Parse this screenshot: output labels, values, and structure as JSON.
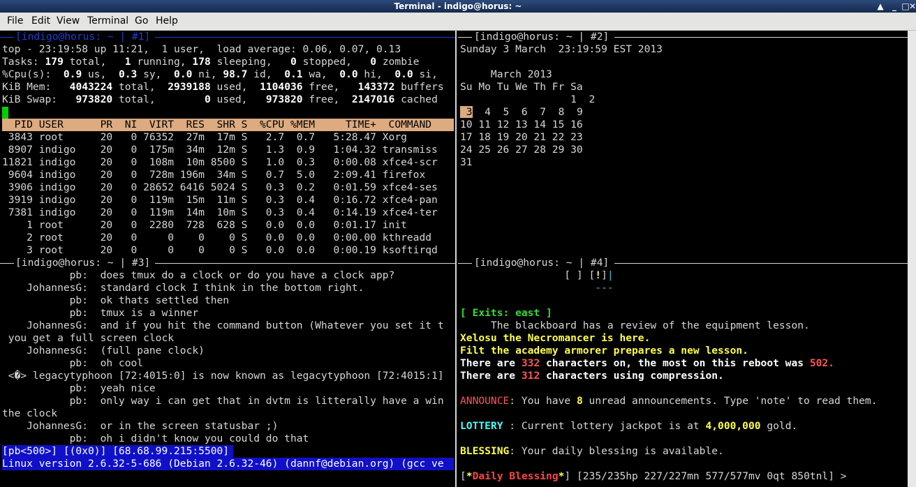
{
  "window": {
    "title": "Terminal - indigo@horus: ~",
    "btn_up": "▲",
    "btn_min": "_",
    "btn_max": "□",
    "btn_close": "✕"
  },
  "menu": [
    "File",
    "Edit",
    "View",
    "Terminal",
    "Go",
    "Help"
  ],
  "pane1": {
    "title": "[indigo@horus: ~ | #1]",
    "top_line": "top - 23:19:58 up 11:21,  1 user,  load average: 0.06, 0.07, 0.13",
    "tasks": {
      "label": "Tasks:",
      "total": "179",
      "total_l": " total,   ",
      "running": "1",
      "running_l": " running, ",
      "sleeping": "178",
      "sleeping_l": " sleeping,   ",
      "stopped": "0",
      "stopped_l": " stopped,   ",
      "zombie": "0",
      "zombie_l": " zombie"
    },
    "cpu": {
      "label": "%Cpu(s):  ",
      "us": "0.9",
      "us_l": " us,  ",
      "sy": "0.3",
      "sy_l": " sy,  ",
      "ni": "0.0",
      "ni_l": " ni, ",
      "id": "98.7",
      "id_l": " id,  ",
      "wa": "0.1",
      "wa_l": " wa,  ",
      "hi": "0.0",
      "hi_l": " hi,  ",
      "si": "0.0",
      "si_l": " si,"
    },
    "mem": {
      "label": "KiB Mem:   ",
      "total": "4043224",
      "total_l": " total,  ",
      "used": "2939188",
      "used_l": " used,  ",
      "free": "1104036",
      "free_l": " free,   ",
      "buffers": "143372",
      "buffers_l": " buffers"
    },
    "swap": {
      "label": "KiB Swap:   ",
      "total": "973820",
      "total_l": " total,        ",
      "used": "0",
      "used_l": " used,   ",
      "free": "973820",
      "free_l": " free,  ",
      "cached": "2147016",
      "cached_l": " cached"
    },
    "table_header": "  PID USER      PR  NI  VIRT  RES  SHR S  %CPU %MEM     TIME+  COMMAND       ",
    "rows": [
      " 3843 root      20   0 76352  27m  17m S   2.7  0.7   5:28.47 Xorg",
      " 8907 indigo    20   0  175m  34m  12m S   1.3  0.9   1:04.32 transmiss",
      "11821 indigo    20   0  108m  10m 8500 S   1.0  0.3   0:00.08 xfce4-scr",
      " 9604 indigo    20   0  728m 196m  34m S   0.7  5.0   2:09.41 firefox",
      " 3906 indigo    20   0 28652 6416 5024 S   0.3  0.2   0:01.59 xfce4-ses",
      " 3919 indigo    20   0  119m  15m  11m S   0.3  0.4   0:16.72 xfce4-pan",
      " 7381 indigo    20   0  119m  14m  10m S   0.3  0.4   0:14.19 xfce4-ter",
      "    1 root      20   0  2280  728  628 S   0.0  0.0   0:01.17 init",
      "    2 root      20   0     0    0    0 S   0.0  0.0   0:00.00 kthreadd",
      "    3 root      20   0     0    0    0 S   0.0  0.0   0:00.19 ksoftirqd"
    ]
  },
  "pane2": {
    "title": "[indigo@horus: ~ | #2]",
    "date": "Sunday 3 March  23:19:59 EST 2013",
    "cal_title": "     March 2013",
    "cal_head": "Su Mo Tu We Th Fr Sa",
    "week1_pre": "                  1  2",
    "today": " 3",
    "week2_rest": "  4  5  6  7  8  9",
    "weeks": [
      "10 11 12 13 14 15 16",
      "17 18 19 20 21 22 23",
      "24 25 26 27 28 29 30",
      "31"
    ]
  },
  "pane3": {
    "title": "[indigo@horus: ~ | #3]",
    "lines": [
      "           pb:  does tmux do a clock or do you have a clock app?",
      "    JohannesG:  standard clock I think in the bottom right.",
      "           pb:  ok thats settled then",
      "           pb:  tmux is a winner",
      "    JohannesG:  and if you hit the command button (Whatever you set it t",
      " you get a full screen clock",
      "    JohannesG:  (full pane clock)",
      "           pb:  oh cool",
      " <�> legacytyphoon [72:4015:0] is now known as legacytyphoon [72:4015:1]",
      "           pb:  yeah nice",
      "           pb:  only way i can get that in dvtm is litterally have a win",
      "the clock",
      "    JohannesG:  or in the screen statusbar ;)",
      "           pb:  oh i didn't know you could do that"
    ],
    "status": "[pb<500>] [(0x0)] [68.68.99.215:5500]",
    "kernel": "Linux version 2.6.32-5-686 (Debian 2.6.32-46) (dannf@debian.org) (gcc ve"
  },
  "pane4": {
    "title": "[indigo@horus: ~ | #4]",
    "map1_a": "                 [ ] [",
    "map1_b": "!",
    "map1_c": "]",
    "map1_d": "|",
    "map2": "                      ---",
    "exits": "[ Exits: east ]",
    "desc": "     The blackboard has a review of the equipment lesson.",
    "npc1": "Xelosu the Necromancer is here.",
    "npc2": "Filt the academy armorer prepares a new lesson.",
    "chars1_a": "There are ",
    "chars1_n": "332",
    "chars1_b": " characters on, the most on this reboot was ",
    "chars1_m": "502",
    "chars1_c": ".",
    "chars2_a": "There are ",
    "chars2_n": "312",
    "chars2_b": " characters using compression.",
    "ann_label": "ANNOUNCE",
    "ann_a": ": You have ",
    "ann_n": "8",
    "ann_b": " unread announcements. Type 'note' to read them.",
    "lot_label": "LOTTERY",
    "lot_a": " : Current lottery jackpot is at ",
    "lot_n": "4,000,000",
    "lot_b": " gold.",
    "bless_label": "BLESSING",
    "bless_a": ": Your daily blessing is available.",
    "prompt_a": "[",
    "prompt_star": "*",
    "prompt_b": "Daily Blessing",
    "prompt_c": "*",
    "prompt_d": "] [235/235hp 227/227mn 577/577mv 0qt 850tnl] >"
  },
  "colors": {
    "accent": "#dcab80",
    "statusbar": "#1010c8",
    "cursor": "#00d000"
  }
}
